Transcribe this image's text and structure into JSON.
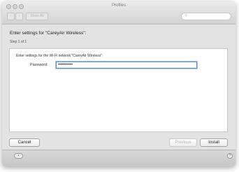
{
  "window": {
    "title": "Profiles"
  },
  "toolbar": {
    "show_all_label": "Show All",
    "back_icon": "chevron-left-icon",
    "forward_icon": "chevron-right-icon",
    "search_icon": "magnifier-icon"
  },
  "wizard": {
    "heading": "Enter settings for \"CareyAir Wireless\":",
    "step": "Step 1 of 1",
    "instruction": "Enter settings for the Wi-Fi network \"CareyAir Wireless\":",
    "password_label": "Password:",
    "password_value": "••••••••••"
  },
  "buttons": {
    "cancel": "Cancel",
    "previous": "Previous",
    "install": "Install"
  },
  "footer": {
    "lock_icon": "lock-icon",
    "help_icon": "help-icon",
    "help_glyph": "?",
    "lock_glyph": "•"
  }
}
